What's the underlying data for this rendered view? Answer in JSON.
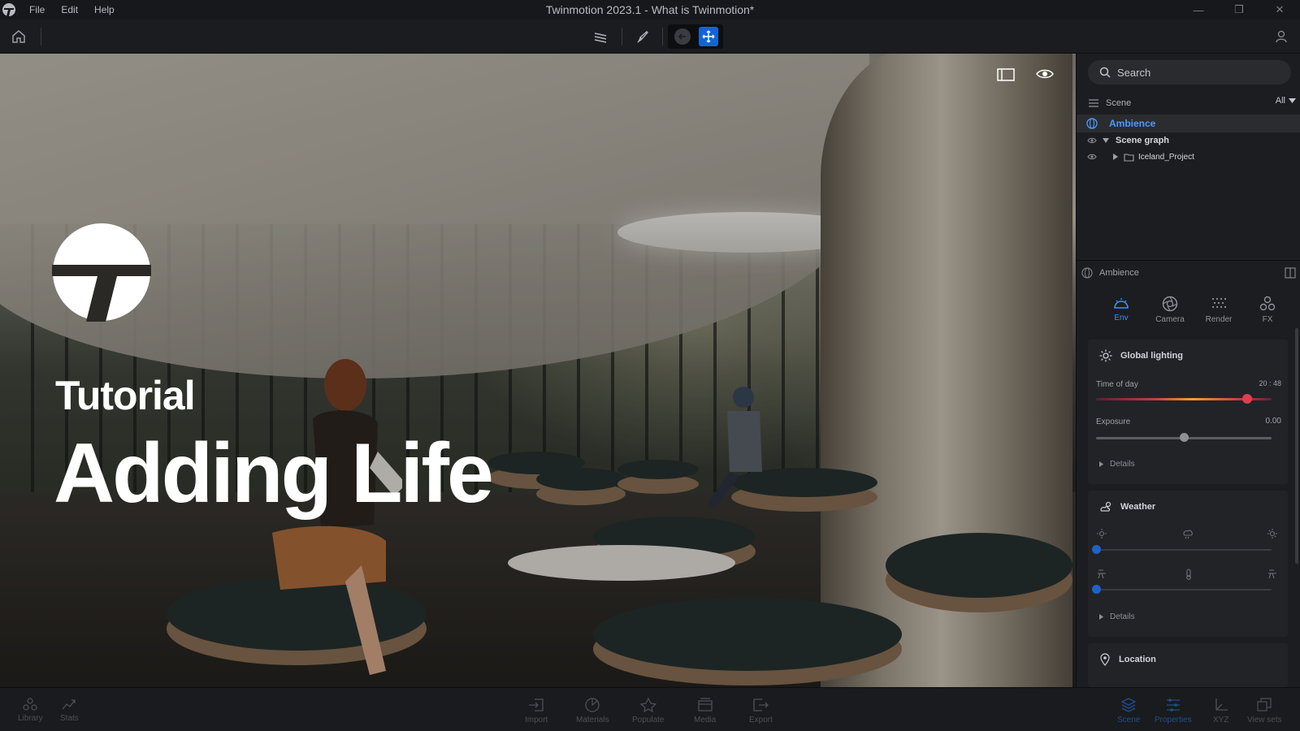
{
  "window": {
    "title": "Twinmotion 2023.1 - What is Twinmotion*",
    "menu": [
      "File",
      "Edit",
      "Help"
    ],
    "controls": {
      "minimize": "—",
      "restore": "❐",
      "close": "✕"
    }
  },
  "viewport": {
    "overlay_label": "Tutorial",
    "overlay_title": "Adding Life"
  },
  "search": {
    "placeholder": "Search"
  },
  "scene": {
    "header": "Scene",
    "filter": "All",
    "items": [
      {
        "label": "Ambience",
        "selected": true
      },
      {
        "label": "Scene graph",
        "expanded": true
      },
      {
        "label": "Iceland_Project",
        "expanded": false
      }
    ]
  },
  "properties": {
    "header": "Ambience",
    "tabs": [
      {
        "label": "Env",
        "active": true,
        "icon": "env-icon"
      },
      {
        "label": "Camera",
        "active": false,
        "icon": "camera-icon"
      },
      {
        "label": "Render",
        "active": false,
        "icon": "render-icon"
      },
      {
        "label": "FX",
        "active": false,
        "icon": "fx-icon"
      }
    ],
    "global_lighting": {
      "title": "Global lighting",
      "time_of_day_label": "Time of day",
      "time_of_day_value": "20 : 48",
      "time_of_day_fraction": 0.86,
      "exposure_label": "Exposure",
      "exposure_value": "0.00",
      "exposure_fraction": 0.5,
      "details": "Details"
    },
    "weather": {
      "title": "Weather",
      "row1_fraction": 0.0,
      "row2_fraction": 0.0,
      "details": "Details"
    },
    "location": {
      "title": "Location"
    }
  },
  "bottom_bar": {
    "left": [
      "Library",
      "Stats"
    ],
    "center": [
      "Import",
      "Materials",
      "Populate",
      "Media",
      "Export"
    ],
    "right": [
      {
        "label": "Scene",
        "active": true
      },
      {
        "label": "Properties",
        "active": true
      },
      {
        "label": "XYZ",
        "active": false
      },
      {
        "label": "View sets",
        "active": false
      }
    ]
  },
  "colors": {
    "accent": "#3f8ef5",
    "active_tool": "#1264d6",
    "text_white": "#ffffff"
  }
}
